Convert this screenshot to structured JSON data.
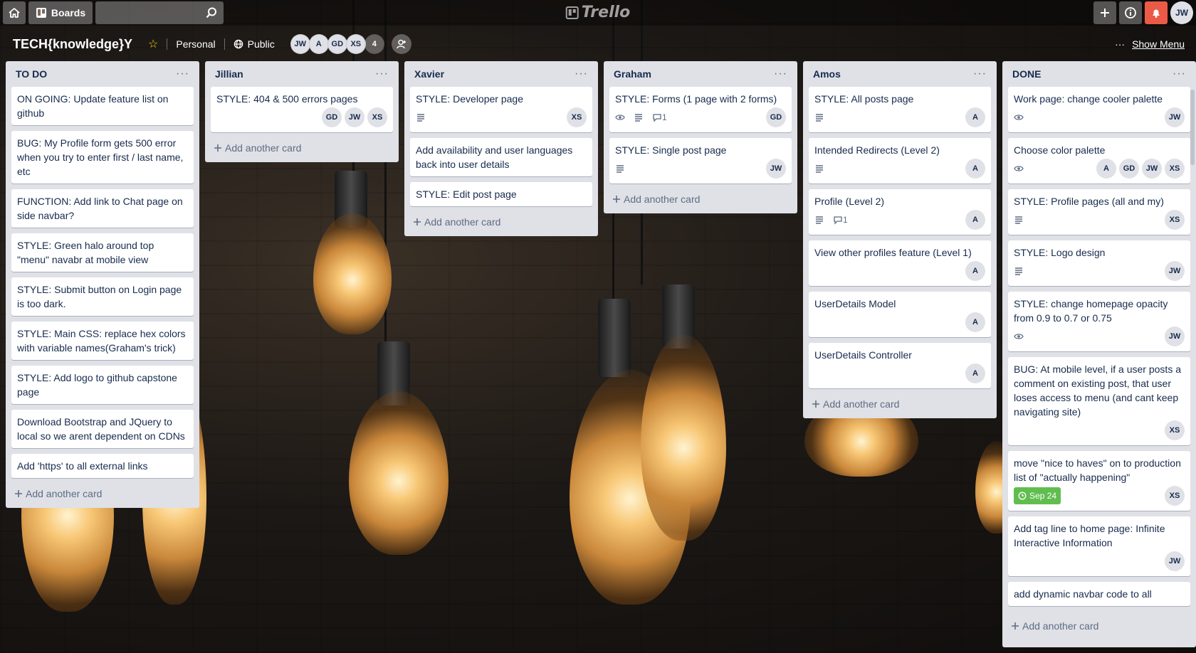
{
  "header": {
    "boards_label": "Boards",
    "search_placeholder": "",
    "logo_text": "Trello",
    "user_initials": "JW"
  },
  "board": {
    "title": "TECH{knowledge}Y",
    "team": "Personal",
    "visibility": "Public",
    "members": [
      "JW",
      "A",
      "GD",
      "XS"
    ],
    "member_overflow": "4",
    "show_menu_label": "Show Menu"
  },
  "add_card_label": "Add another card",
  "lists": [
    {
      "title": "TO DO",
      "cards": [
        {
          "text": "ON GOING: Update feature list on github"
        },
        {
          "text": "BUG: My Profile form gets 500 error when you try to enter first / last name, etc"
        },
        {
          "text": "FUNCTION: Add link to Chat page on side navbar?"
        },
        {
          "text": "STYLE: Green halo around top \"menu\" navabr at mobile view"
        },
        {
          "text": "STYLE: Submit button on Login page is too dark."
        },
        {
          "text": "STYLE: Main CSS: replace hex colors with variable names(Graham's trick)"
        },
        {
          "text": "STYLE: Add logo to github capstone page"
        },
        {
          "text": "Download Bootstrap and JQuery to local so we arent dependent on CDNs"
        },
        {
          "text": "Add 'https' to all external links"
        }
      ]
    },
    {
      "title": "Jillian",
      "cards": [
        {
          "text": "STYLE: 404 & 500 errors pages",
          "members": [
            "GD",
            "JW",
            "XS"
          ]
        }
      ]
    },
    {
      "title": "Xavier",
      "cards": [
        {
          "text": "STYLE: Developer page",
          "desc": true,
          "members": [
            "XS"
          ]
        },
        {
          "text": "Add availability and user languages back into user details"
        },
        {
          "text": "STYLE: Edit post page"
        }
      ]
    },
    {
      "title": "Graham",
      "cards": [
        {
          "text": "STYLE: Forms (1 page with 2 forms)",
          "watch": true,
          "desc": true,
          "comments": "1",
          "members": [
            "GD"
          ]
        },
        {
          "text": "STYLE: Single post page",
          "desc": true,
          "members": [
            "JW"
          ]
        }
      ]
    },
    {
      "title": "Amos",
      "cards": [
        {
          "text": "STYLE: All posts page",
          "desc": true,
          "members": [
            "A"
          ]
        },
        {
          "text": "Intended Redirects (Level 2)",
          "desc": true,
          "members": [
            "A"
          ]
        },
        {
          "text": "Profile (Level 2)",
          "desc": true,
          "comments": "1",
          "members": [
            "A"
          ]
        },
        {
          "text": "View other profiles feature (Level 1)",
          "members": [
            "A"
          ]
        },
        {
          "text": "UserDetails Model",
          "members": [
            "A"
          ]
        },
        {
          "text": "UserDetails Controller",
          "members": [
            "A"
          ]
        }
      ]
    },
    {
      "title": "DONE",
      "cards": [
        {
          "text": "Work page: change cooler palette",
          "watch": true,
          "members": [
            "JW"
          ]
        },
        {
          "text": "Choose color palette",
          "watch": true,
          "members": [
            "A",
            "GD",
            "JW",
            "XS"
          ]
        },
        {
          "text": "STYLE: Profile pages (all and my)",
          "desc": true,
          "members": [
            "XS"
          ]
        },
        {
          "text": "STYLE: Logo design",
          "desc": true,
          "members": [
            "JW"
          ]
        },
        {
          "text": "STYLE: change homepage opacity from 0.9 to 0.7 or 0.75",
          "watch": true,
          "members": [
            "JW"
          ]
        },
        {
          "text": "BUG: At mobile level, if a user posts a comment on existing post, that user loses access to menu (and cant keep navigating site)",
          "members": [
            "XS"
          ]
        },
        {
          "text": "move \"nice to haves\" on to production list of \"actually happening\"",
          "due": "Sep 24",
          "members": [
            "XS"
          ]
        },
        {
          "text": "Add tag line to home page: Infinite Interactive Information",
          "members": [
            "JW"
          ]
        },
        {
          "text": "add dynamic navbar code to all"
        }
      ]
    }
  ],
  "colors": {
    "list_bg": "#dfe1e6",
    "card_bg": "#ffffff",
    "due_badge": "#61bd4f",
    "notification": "#eb5a46",
    "star": "#f2d600"
  }
}
